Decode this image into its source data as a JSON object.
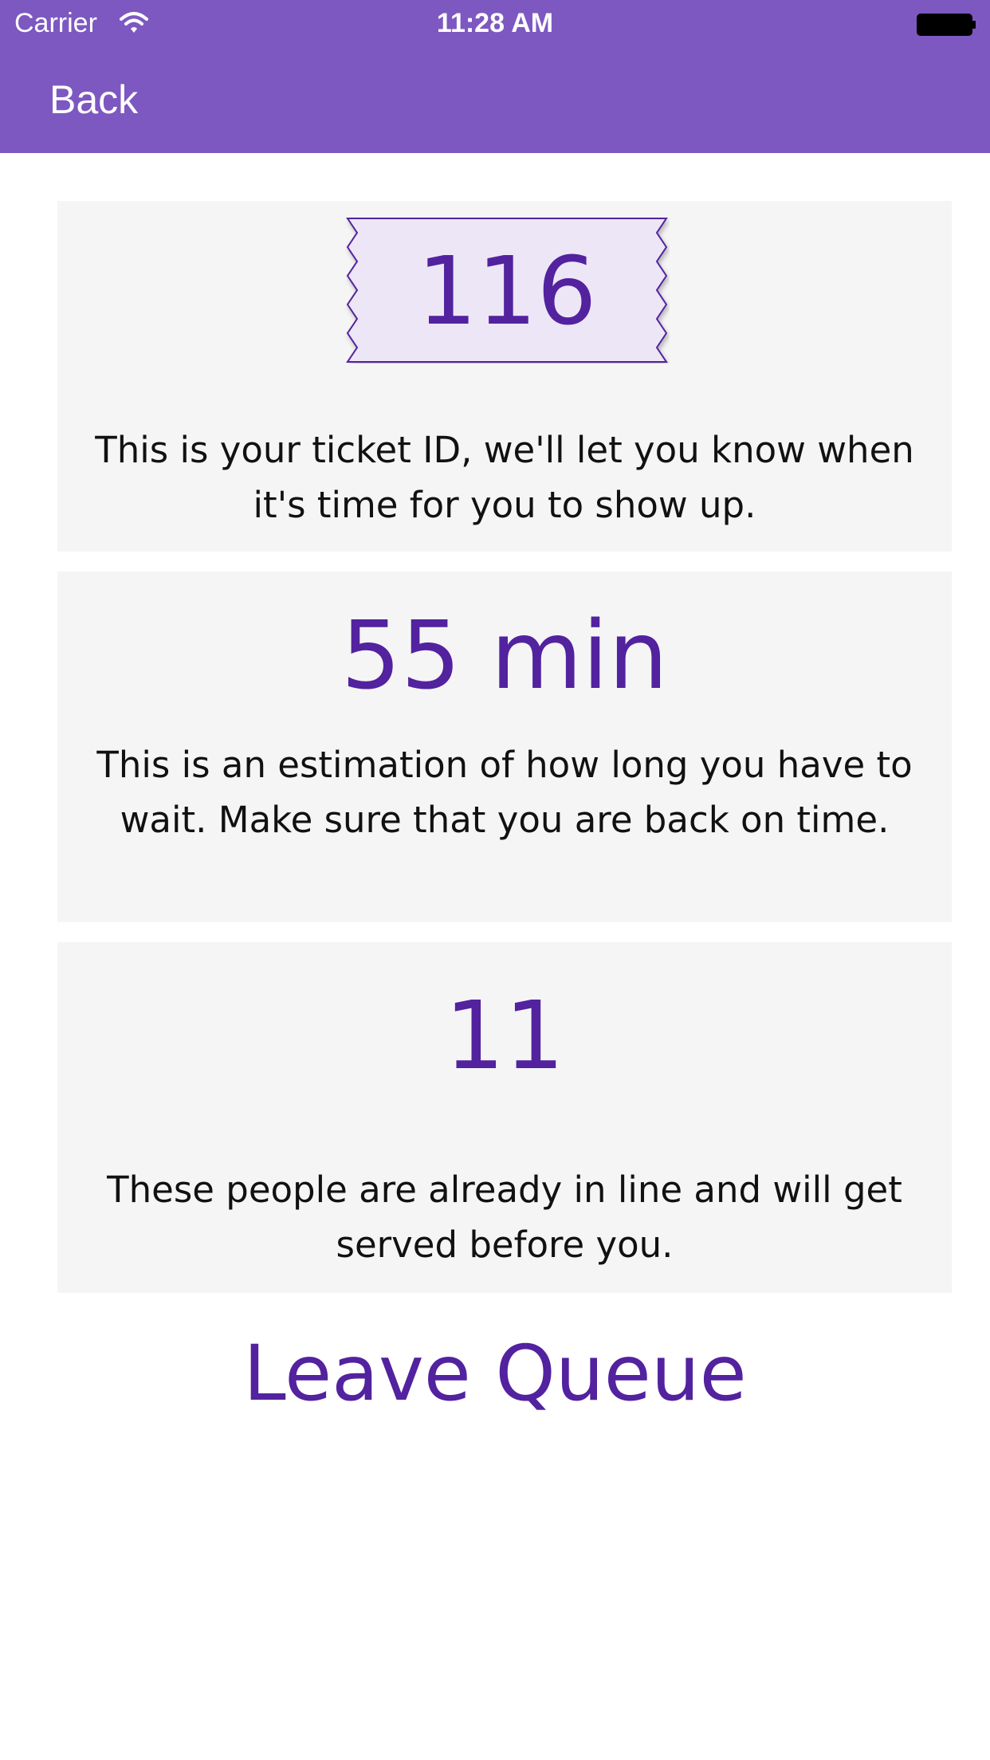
{
  "status_bar": {
    "carrier": "Carrier",
    "time": "11:28 AM",
    "wifi_icon": "wifi-icon",
    "battery_icon": "battery-icon"
  },
  "nav": {
    "back_label": "Back"
  },
  "ticket": {
    "id": "116",
    "description": "This is your ticket ID, we'll let you know when it's time for you to show up."
  },
  "wait": {
    "value": "55 min",
    "description": "This is an estimation of how long you have to wait. Make sure that you are back on time."
  },
  "people": {
    "value": "11",
    "description": "These people are already in line and will get served before you."
  },
  "actions": {
    "leave_queue_label": "Leave Queue"
  },
  "colors": {
    "header": "#7d58c1",
    "accent": "#52229f",
    "card": "#f5f5f5",
    "ticket_fill": "#ede6f6"
  }
}
